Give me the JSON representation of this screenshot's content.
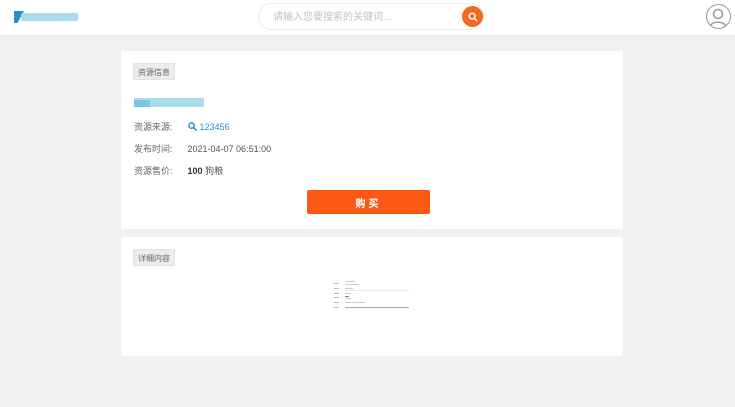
{
  "header": {
    "search_placeholder": "请输入您要搜索的关键词...",
    "accent_color": "#f26a20"
  },
  "resource_card": {
    "tag_label": "资源信息",
    "source_label": "资源来源:",
    "source_value": "123456",
    "time_label": "发布时间:",
    "time_value": "2021-04-07 06:51:00",
    "price_label": "资源售价:",
    "price_value": "100",
    "price_unit": "狗粮",
    "buy_label": "购买",
    "buy_color": "#fb5a14"
  },
  "detail_card": {
    "tag_label": "详细内容"
  }
}
